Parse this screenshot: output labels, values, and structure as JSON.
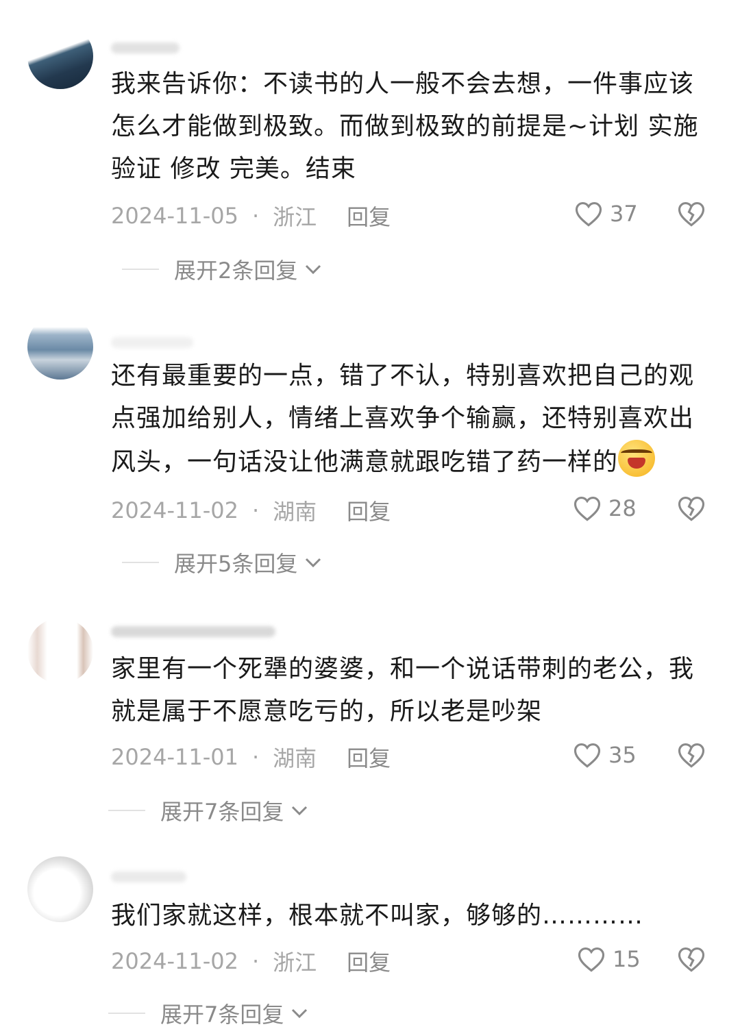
{
  "comments": [
    {
      "text": "我来告诉你：不读书的人一般不会去想，一件事应该怎么才能做到极致。而做到极致的前提是~计划 实施 验证  修改 完美。结束",
      "date": "2024-11-05",
      "location": "浙江",
      "reply_label": "回复",
      "likes": "37",
      "expand_label": "展开2条回复"
    },
    {
      "text": "还有最重要的一点，错了不认，特别喜欢把自己的观点强加给别人，情绪上喜欢争个输赢，还特别喜欢出风头，一句话没让他满意就跟吃错了药一样的",
      "date": "2024-11-02",
      "location": "湖南",
      "reply_label": "回复",
      "likes": "28",
      "expand_label": "展开5条回复"
    },
    {
      "text": "家里有一个死犟的婆婆，和一个说话带刺的老公，我就是属于不愿意吃亏的，所以老是吵架",
      "date": "2024-11-01",
      "location": "湖南",
      "reply_label": "回复",
      "likes": "35",
      "expand_label": "展开7条回复"
    },
    {
      "text": "我们家就这样，根本就不叫家，够够的…………",
      "date": "2024-11-02",
      "location": "浙江",
      "reply_label": "回复",
      "likes": "15",
      "expand_label": "展开7条回复"
    }
  ],
  "separator": "·",
  "icons": {
    "like": "heart-outline-icon",
    "dislike": "broken-heart-icon",
    "expand": "chevron-down-icon",
    "emoji": "laughing-crying-emoji"
  },
  "colors": {
    "text": "#1a1a1a",
    "meta": "#a6a6a6",
    "icon": "#8a8a8a"
  }
}
